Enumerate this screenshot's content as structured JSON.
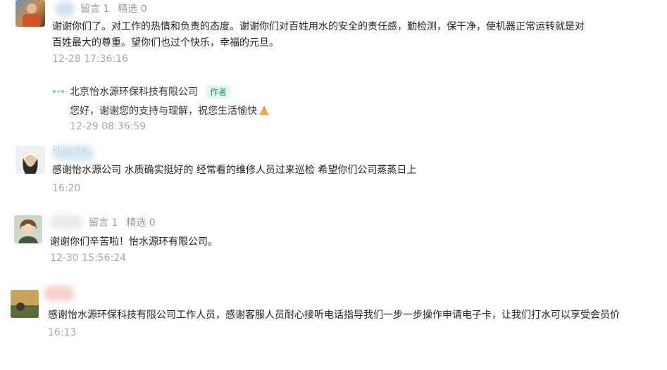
{
  "comments": [
    {
      "leave_msg": "留言 1",
      "selected": "精选 0",
      "text_line1": "谢谢你们了。对工作的热情和负责的态度。谢谢你们对百姓用水的安全的责任感，勤检测，保干净，使机器正常运转就是对",
      "text_line2": "百姓最大的尊重。望你们也过个快乐，幸福的元旦。",
      "time": "12-28 17:36:16",
      "reply": {
        "author": "北京怡水源环保科技有限公司",
        "badge": "作者",
        "text": "您好，谢谢您的支持与理解，祝您生活愉快",
        "time": "12-29 08:36:59"
      }
    },
    {
      "name_partial": "Fl     er  SA .",
      "text": "感谢怡水源公司 水质确实挺好的 经常看的维修人员过来巡检 希望你们公司蒸蒸日上",
      "time": "16:20"
    },
    {
      "leave_msg": "留言 1",
      "selected": "精选 0",
      "text": "谢谢你们辛苦啦！怡水源环有限公司。",
      "time": "12-30 15:56:24"
    },
    {
      "text": "感谢怡水源环保科技有限公司工作人员，感谢客服人员耐心接听电话指导我们一步一步操作申请电子卡，让我们打水可以享受会员价",
      "time": "16:13"
    }
  ]
}
